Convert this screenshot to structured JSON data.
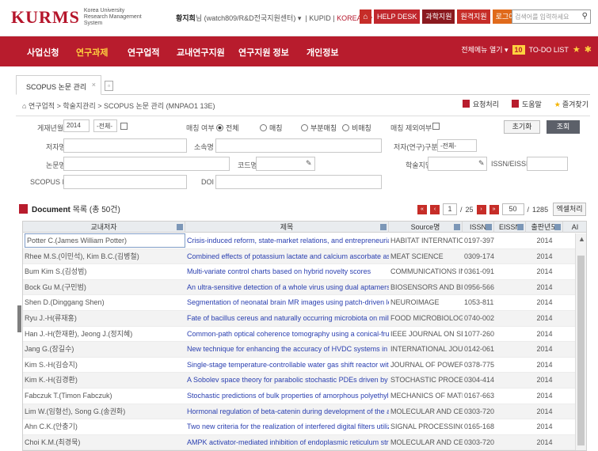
{
  "header": {
    "logo": "KURMS",
    "logo_sub": "Korea University Research Management System",
    "user_name": "황지희",
    "user_suffix": "님 (watch809/R&D전국지원센터) ▾",
    "kupid": "KUPID",
    "lang": "KOREAN ▾",
    "buttons": [
      "HELP DESK",
      "과학지원",
      "원격지원",
      "로그아웃"
    ],
    "search_placeholder": "검색어를 입력하세요"
  },
  "nav": {
    "items": [
      "사업신청",
      "연구과제",
      "연구업적",
      "교내연구지원",
      "연구지원 정보",
      "개인정보"
    ],
    "active_index": 1,
    "menu_all": "전체메뉴 열기 ▾",
    "todo_count": "10",
    "todo_label": "TO-DO LIST"
  },
  "tab": {
    "label": "SCOPUS 논문 관리",
    "close": "×"
  },
  "breadcrumb": "연구업적 > 학술지관리 > SCOPUS 논문 관리 (MNPAO1 13E)",
  "actions": [
    "요청처리",
    "도움말",
    "즐겨찾기"
  ],
  "form": {
    "year_label": "게재년월",
    "year_value": "2014",
    "month_value": "-전체-",
    "match_label": "매칭 여부",
    "match_options": [
      "전체",
      "매칭",
      "부분매칭",
      "비매칭"
    ],
    "match_selected": 0,
    "except_label": "매칭 제외여부",
    "author_label": "저자명",
    "dept_label": "소속명",
    "role_label": "저자(연구)구분",
    "role_value": "-전체-",
    "paper_label": "논문명",
    "journal_label": "학술지명",
    "issn_label": "ISSN/EISSN",
    "code_label": "코드명",
    "scopus_label": "SCOPUS ID",
    "doi_label": "DOI",
    "reset": "초기화",
    "search": "조회"
  },
  "list": {
    "title": "Document",
    "list_label": "목록",
    "total_prefix": "(총",
    "total": "50건)",
    "page": "1",
    "pages": "25",
    "per_page": "50",
    "count": "1285",
    "excel": "엑셀처리"
  },
  "grid": {
    "columns": [
      "교내저자",
      "제목",
      "Source명",
      "ISSN",
      "EISSN",
      "출판년도",
      "AI"
    ],
    "rows": [
      {
        "author": "Potter C.(James William Potter)",
        "title": "Crisis-induced reform, state-market relations, and entrepreneurial urban gro",
        "source": "HABITAT INTERNATIONAL",
        "issn": "0197-3975",
        "year": "2014"
      },
      {
        "author": "Rhee M.S.(이민석), Kim B.C.(김병철)",
        "title": "Combined effects of potassium lactate and calcium ascorbate as sodium cl",
        "source": "MEAT SCIENCE",
        "issn": "0309-1740",
        "year": "2014"
      },
      {
        "author": "Bum Kim S.(김성범)",
        "title": "Multi-variate control charts based on hybrid novelty scores",
        "source": "COMMUNICATIONS IN ST",
        "issn": "0361-0918",
        "year": "2014"
      },
      {
        "author": "Bock Gu M.(구민범)",
        "title": "An ultra-sensitive detection of a whole virus using dual aptamers developed",
        "source": "BIOSENSORS AND BIOEL",
        "issn": "0956-5663",
        "year": "2014"
      },
      {
        "author": "Shen D.(Dinggang Shen)",
        "title": "Segmentation of neonatal brain MR images using patch-driven level sets",
        "source": "NEUROIMAGE",
        "issn": "1053-8119",
        "year": "2014"
      },
      {
        "author": "Ryu J.-H(류재홍)",
        "title": "Fate of bacillus cereus and naturally occurring microbiota on milled rice as",
        "source": "FOOD MICROBIOLOGY",
        "issn": "0740-0020",
        "year": "2014"
      },
      {
        "author": "Han J.-H(한재환), Jeong J.(정지혜)",
        "title": "Common-path optical coherence tomography using a conical-frustum-tip fi",
        "source": "IEEE JOURNAL ON SELEC",
        "issn": "1077-260X",
        "year": "2014"
      },
      {
        "author": "Jang G.(장길수)",
        "title": "New technique for enhancing the accuracy of HVDC systems in state estima",
        "source": "INTERNATIONAL JOURNA",
        "issn": "0142-0615",
        "year": "2014"
      },
      {
        "author": "Kim S.-H(김승지)",
        "title": "Single-stage temperature-controllable water gas shift reactor with catalytic r",
        "source": "JOURNAL OF POWER SOU",
        "issn": "0378-7753",
        "year": "2014"
      },
      {
        "author": "Kim K.-H(김경환)",
        "title": "A Sobolev space theory for parabolic stochastic PDEs driven by Lévy proce",
        "source": "STOCHASTIC PROCESSE",
        "issn": "0304-4149",
        "year": "2014"
      },
      {
        "author": "Fabczuk T.(Timon Fabczuk)",
        "title": "Stochastic predictions of bulk properties of amorphous polyethylene based o",
        "source": "MECHANICS OF MATERIA",
        "issn": "0167-6636",
        "year": "2014"
      },
      {
        "author": "Lim W.(임형선), Song G.(송권화)",
        "title": "Hormonal regulation of beta-catenin during development of the avian oviduct",
        "source": "MOLECULAR AND CELLU",
        "issn": "0303-7207",
        "year": "2014"
      },
      {
        "author": "Ahn C.K.(안충기)",
        "title": "Two new criteria for the realization of interfered digital filters utilizing saturati",
        "source": "SIGNAL PROCESSING",
        "issn": "0165-1684",
        "year": "2014"
      },
      {
        "author": "Choi K.M.(최경묵)",
        "title": "AMPK activator-mediated inhibition of endoplasmic reticulum stress amelior",
        "source": "MOLECULAR AND CELLU",
        "issn": "0303-7207",
        "year": "2014"
      }
    ]
  }
}
